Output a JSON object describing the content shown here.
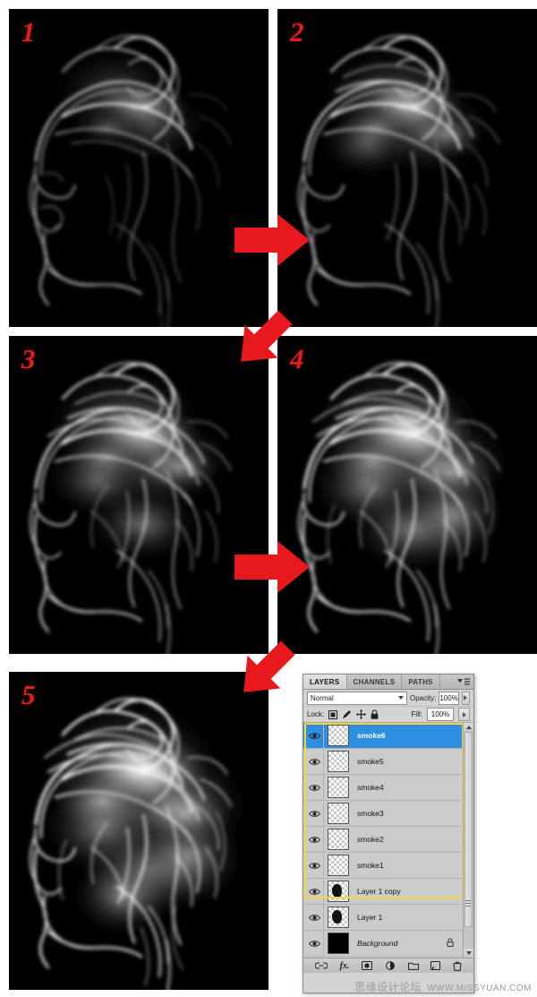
{
  "steps": [
    {
      "number": "1",
      "name": "step-1"
    },
    {
      "number": "2",
      "name": "step-2"
    },
    {
      "number": "3",
      "name": "step-3"
    },
    {
      "number": "4",
      "name": "step-4"
    },
    {
      "number": "5",
      "name": "step-5"
    }
  ],
  "arrows": [
    {
      "name": "arrow-step1-to-step2",
      "direction": "right"
    },
    {
      "name": "arrow-step2-to-step3",
      "direction": "down-left"
    },
    {
      "name": "arrow-step3-to-step4",
      "direction": "right"
    },
    {
      "name": "arrow-step4-to-step5",
      "direction": "down-left"
    }
  ],
  "layers_panel": {
    "tabs": [
      {
        "label": "LAYERS",
        "active": true
      },
      {
        "label": "CHANNELS",
        "active": false
      },
      {
        "label": "PATHS",
        "active": false
      }
    ],
    "panel_menu_icon": "panel-menu-icon",
    "blend_mode": "Normal",
    "opacity_label": "Opacity:",
    "opacity_value": "100%",
    "lock_label": "Lock:",
    "lock_icons": [
      "lock-transparent-pixels-icon",
      "lock-image-pixels-icon",
      "lock-position-icon",
      "lock-all-icon"
    ],
    "fill_label": "Fill:",
    "fill_value": "100%",
    "layers": [
      {
        "name": "smoke6",
        "selected": true,
        "grouped": true,
        "thumb": "transparent",
        "locked": false,
        "italic": false
      },
      {
        "name": "smoke5",
        "selected": false,
        "grouped": true,
        "thumb": "transparent",
        "locked": false,
        "italic": false
      },
      {
        "name": "smoke4",
        "selected": false,
        "grouped": true,
        "thumb": "transparent",
        "locked": false,
        "italic": false
      },
      {
        "name": "smoke3",
        "selected": false,
        "grouped": true,
        "thumb": "transparent",
        "locked": false,
        "italic": false
      },
      {
        "name": "smoke2",
        "selected": false,
        "grouped": true,
        "thumb": "transparent",
        "locked": false,
        "italic": false
      },
      {
        "name": "smoke1",
        "selected": false,
        "grouped": true,
        "thumb": "transparent",
        "locked": false,
        "italic": false
      },
      {
        "name": "Layer 1 copy",
        "selected": false,
        "grouped": false,
        "thumb": "mask",
        "locked": false,
        "italic": false
      },
      {
        "name": "Layer 1",
        "selected": false,
        "grouped": false,
        "thumb": "mask",
        "locked": false,
        "italic": false
      },
      {
        "name": "Background",
        "selected": false,
        "grouped": false,
        "thumb": "black",
        "locked": true,
        "italic": true
      }
    ],
    "bottom_icons": [
      "link-layers-icon",
      "layer-style-fx-icon",
      "add-layer-mask-icon",
      "new-adjustment-layer-icon",
      "new-group-icon",
      "new-layer-icon",
      "delete-layer-icon"
    ],
    "selection_color": "#2e8fe0",
    "group_outline_color": "#f2d63b"
  },
  "watermark": {
    "chinese": "思缘设计论坛",
    "english": "WWW.MISSYUAN.COM"
  }
}
